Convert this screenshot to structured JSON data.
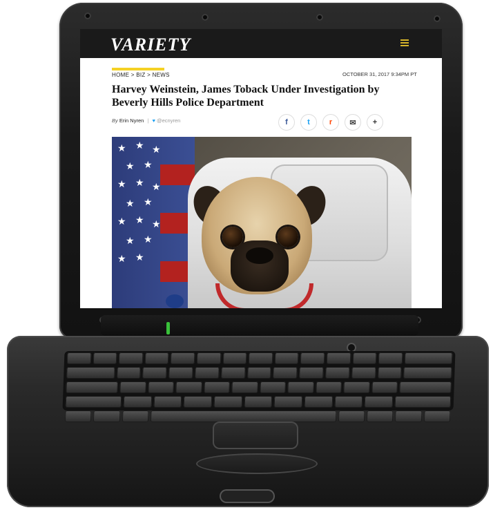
{
  "site": {
    "logo": "VARIETY"
  },
  "article": {
    "breadcrumb": "HOME > BIZ > NEWS",
    "date": "OCTOBER 31, 2017 9:34PM PT",
    "headline": "Harvey Weinstein, James Toback Under Investigation by Beverly Hills Police Department",
    "byline_prefix": "By",
    "author": "Erin Nyren",
    "separator": "|",
    "twitter_handle": "@ecnyren"
  },
  "share": {
    "icons": [
      "facebook-icon",
      "twitter-icon",
      "reddit-icon",
      "email-icon",
      "plus-icon"
    ],
    "glyphs": {
      "facebook": "f",
      "twitter": "t",
      "reddit": "r",
      "email": "✉",
      "plus": "+"
    }
  },
  "colors": {
    "accent_yellow": "#f5d125",
    "topbar": "#1a1a1a",
    "facebook": "#3b5998",
    "twitter": "#1da1f2",
    "reddit": "#ff4500",
    "power_led": "#39c13a"
  }
}
